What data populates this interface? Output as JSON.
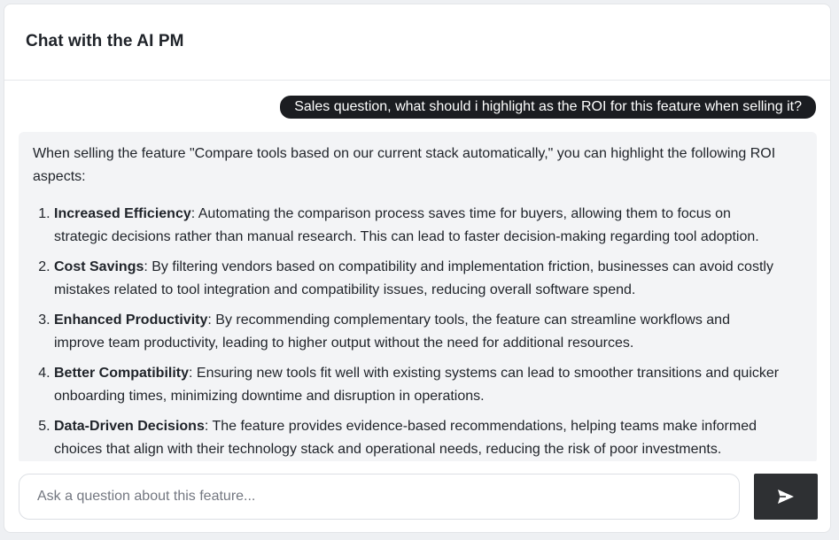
{
  "header": {
    "title": "Chat with the AI PM"
  },
  "messages": {
    "user": "Sales question, what should i highlight as the ROI for this feature when selling it?",
    "assistant": {
      "intro": "When selling the feature \"Compare tools based on our current stack automatically,\" you can highlight the following ROI aspects:",
      "points": [
        {
          "title": "Increased Efficiency",
          "text": ": Automating the comparison process saves time for buyers, allowing them to focus on strategic decisions rather than manual research. This can lead to faster decision-making regarding tool adoption."
        },
        {
          "title": "Cost Savings",
          "text": ": By filtering vendors based on compatibility and implementation friction, businesses can avoid costly mistakes related to tool integration and compatibility issues, reducing overall software spend."
        },
        {
          "title": "Enhanced Productivity",
          "text": ": By recommending complementary tools, the feature can streamline workflows and improve team productivity, leading to higher output without the need for additional resources."
        },
        {
          "title": "Better Compatibility",
          "text": ": Ensuring new tools fit well with existing systems can lead to smoother transitions and quicker onboarding times, minimizing downtime and disruption in operations."
        },
        {
          "title": "Data-Driven Decisions",
          "text": ": The feature provides evidence-based recommendations, helping teams make informed choices that align with their technology stack and operational needs, reducing the risk of poor investments."
        }
      ]
    }
  },
  "composer": {
    "placeholder": "Ask a question about this feature...",
    "value": "",
    "send_icon": "send-arrow-icon"
  },
  "colors": {
    "user_bubble": "#1b1d21",
    "assistant_bubble": "#f3f4f6",
    "send_button": "#2e3033"
  }
}
